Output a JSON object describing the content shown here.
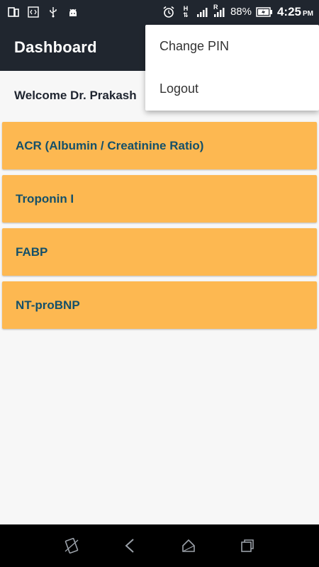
{
  "status_bar": {
    "battery": "88%",
    "time": "4:25",
    "ampm": "PM",
    "network_h": "H",
    "network_r": "R"
  },
  "app_bar": {
    "title": "Dashboard"
  },
  "welcome": {
    "text": "Welcome Dr. Prakash"
  },
  "tests": [
    {
      "label": "ACR (Albumin / Creatinine Ratio)"
    },
    {
      "label": "Troponin I"
    },
    {
      "label": "FABP"
    },
    {
      "label": "NT-proBNP"
    }
  ],
  "menu": {
    "items": [
      {
        "label": "Change PIN"
      },
      {
        "label": "Logout"
      }
    ]
  },
  "colors": {
    "app_bar": "#20262f",
    "card": "#fdb851",
    "card_text": "#14506a",
    "background": "#f7f7f7"
  },
  "icons": {
    "status_left": [
      "phone-tablet-icon",
      "code-icon",
      "usb-icon",
      "android-icon"
    ],
    "status_right": [
      "alarm-icon",
      "data-arrows-icon",
      "signal-icon",
      "signal-roaming-icon",
      "battery-charging-icon"
    ],
    "nav": [
      "screen-rotate-icon",
      "back-icon",
      "home-icon",
      "recents-icon"
    ]
  }
}
